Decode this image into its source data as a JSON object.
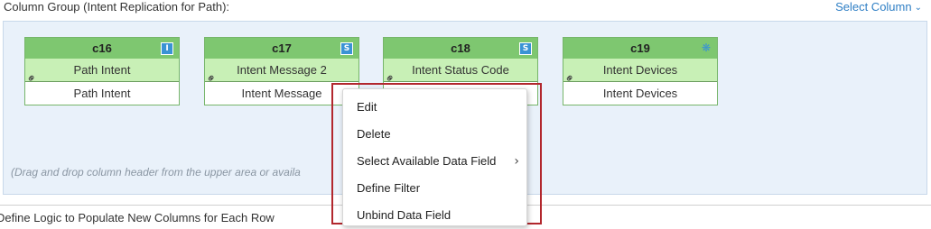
{
  "header": {
    "title": "Column Group (Intent Replication for Path):",
    "select_column_label": "Select Column",
    "select_column_icon": "chevron-down-icon"
  },
  "columns": [
    {
      "id": "c16",
      "badge": "I",
      "badge_icon": "type-integer-icon",
      "field": "Path Intent",
      "source": "Path Intent"
    },
    {
      "id": "c17",
      "badge": "S",
      "badge_icon": "type-string-icon",
      "field": "Intent Message 2",
      "source": "Intent Message"
    },
    {
      "id": "c18",
      "badge": "S",
      "badge_icon": "type-string-icon",
      "field": "Intent Status Code",
      "source": ""
    },
    {
      "id": "c19",
      "badge": "",
      "badge_icon": "device-type-icon",
      "field": "Intent Devices",
      "source": "Intent Devices"
    }
  ],
  "drop_hint": "(Drag and drop column header from the upper area or availa",
  "context_menu": {
    "items": [
      "Edit",
      "Delete",
      "Select Available Data Field",
      "Define Filter",
      "Unbind Data Field"
    ],
    "submenu_arrow": "chevron-right-icon"
  },
  "bottom": {
    "title": "Define Logic to Populate New Columns for Each Row"
  },
  "colors": {
    "header_green": "#7ec770",
    "row_green": "#c8f0b6",
    "area_bg": "#e9f1fa",
    "link_blue": "#2f7fc5",
    "highlight_red": "#b2272d"
  }
}
